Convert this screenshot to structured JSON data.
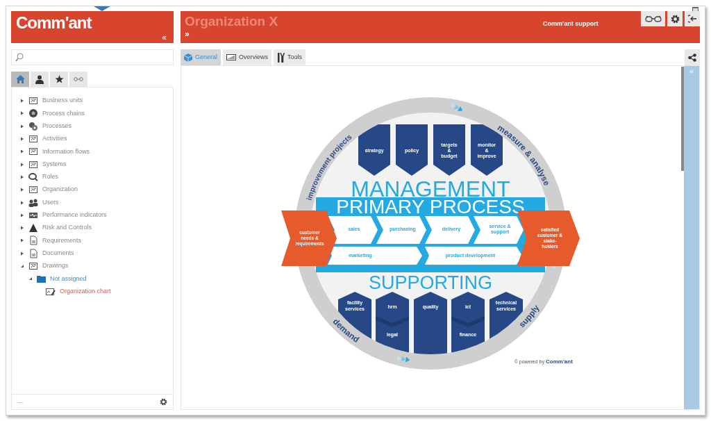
{
  "left_header": {
    "logo": "Comm'ant",
    "collapse": "«"
  },
  "nav_tabs": [
    {
      "kind": "home",
      "selected": true
    },
    {
      "kind": "person",
      "selected": false
    },
    {
      "kind": "star",
      "selected": false
    },
    {
      "kind": "link",
      "selected": false
    }
  ],
  "tree": [
    {
      "label": "Business units",
      "expanded": false
    },
    {
      "label": "Process chains",
      "expanded": false
    },
    {
      "label": "Processes",
      "expanded": false
    },
    {
      "label": "Activities",
      "expanded": false
    },
    {
      "label": "Information flows",
      "expanded": false
    },
    {
      "label": "Systems",
      "expanded": false
    },
    {
      "label": "Roles",
      "expanded": false
    },
    {
      "label": "Organization",
      "expanded": false
    },
    {
      "label": "Users",
      "expanded": false
    },
    {
      "label": "Performance indicators",
      "expanded": false
    },
    {
      "label": "Risk and Controls",
      "expanded": false
    },
    {
      "label": "Requirements",
      "expanded": false
    },
    {
      "label": "Documents",
      "expanded": false
    },
    {
      "label": "Drawings",
      "expanded": true,
      "children": [
        {
          "label": "Not assigned",
          "kind": "folder",
          "expanded": true,
          "children": [
            {
              "label": "Organization chart",
              "kind": "drawing",
              "selected": true
            }
          ]
        }
      ]
    }
  ],
  "tree_footer": {
    "text": "—"
  },
  "main_header": {
    "title": "Organization X",
    "expand": "»",
    "user": "Comm'ant support"
  },
  "tabs": [
    {
      "label": "General",
      "selected": true
    },
    {
      "label": "Overviews",
      "selected": false
    },
    {
      "label": "Tools",
      "selected": false
    }
  ],
  "side_strip": {
    "collapse": "«"
  },
  "diagram": {
    "arcs": [
      "improvement projects",
      "measure & analyse",
      "demand",
      "supply"
    ],
    "management": {
      "title": "MANAGEMENT",
      "blocks": [
        [
          "strategy"
        ],
        [
          "policy"
        ],
        [
          "targets",
          "&",
          "budget"
        ],
        [
          "monitor",
          "&",
          "improve"
        ]
      ]
    },
    "primary": {
      "title": "PRIMARY PROCESS",
      "input": [
        "customer",
        "needs &",
        "requirements"
      ],
      "output": [
        "satisfied",
        "customer &",
        "stake-",
        "holders"
      ],
      "steps": [
        [
          "sales"
        ],
        [
          "purchasing"
        ],
        [
          "delivery"
        ],
        [
          "service &",
          "support"
        ]
      ],
      "second_row": [
        "marketing",
        "product development"
      ]
    },
    "supporting": {
      "title": "SUPPORTING",
      "blocks": [
        {
          "top": [
            "facility",
            "services"
          ]
        },
        {
          "top": [
            "hrm"
          ],
          "bottom": [
            "legal"
          ]
        },
        {
          "top": [
            "quality"
          ]
        },
        {
          "top": [
            "ict"
          ],
          "bottom": [
            "finance"
          ]
        },
        {
          "top": [
            "technical",
            "services"
          ]
        }
      ]
    },
    "footer": {
      "prefix": "© powered by",
      "logo": "Comm'ant"
    }
  }
}
